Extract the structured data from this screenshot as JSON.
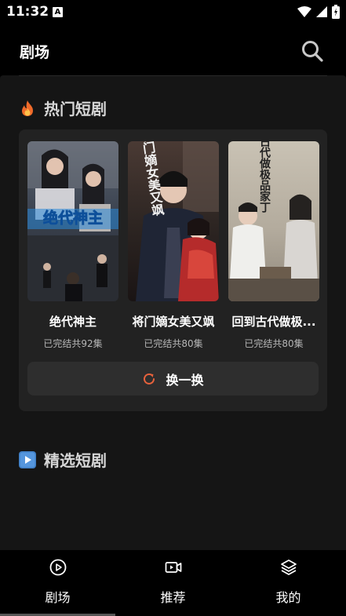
{
  "status_bar": {
    "time": "11:32",
    "notification_badge": "A"
  },
  "header": {
    "title": "剧场",
    "search_icon": "search-icon"
  },
  "hot_section": {
    "title": "热门短剧",
    "icon": "fire-icon",
    "items": [
      {
        "name": "绝代神主",
        "meta": "已完结共92集",
        "poster_text": "绝代神主"
      },
      {
        "name": "将门嫡女美又飒",
        "meta": "已完结共80集",
        "poster_text": "将门嫡女美又飒"
      },
      {
        "name": "回到古代做极...",
        "meta": "已完结共80集",
        "poster_text": "回到古代做极品家丁"
      }
    ],
    "refresh_label": "换一换"
  },
  "featured_section": {
    "title": "精选短剧",
    "icon": "play-square-icon"
  },
  "tabs": [
    {
      "label": "剧场",
      "icon": "play-circle-icon",
      "active": true
    },
    {
      "label": "推荐",
      "icon": "video-icon",
      "active": false
    },
    {
      "label": "我的",
      "icon": "layers-icon",
      "active": false
    }
  ],
  "colors": {
    "accent": "#e8623c",
    "background": "#151515",
    "card": "#222222"
  }
}
